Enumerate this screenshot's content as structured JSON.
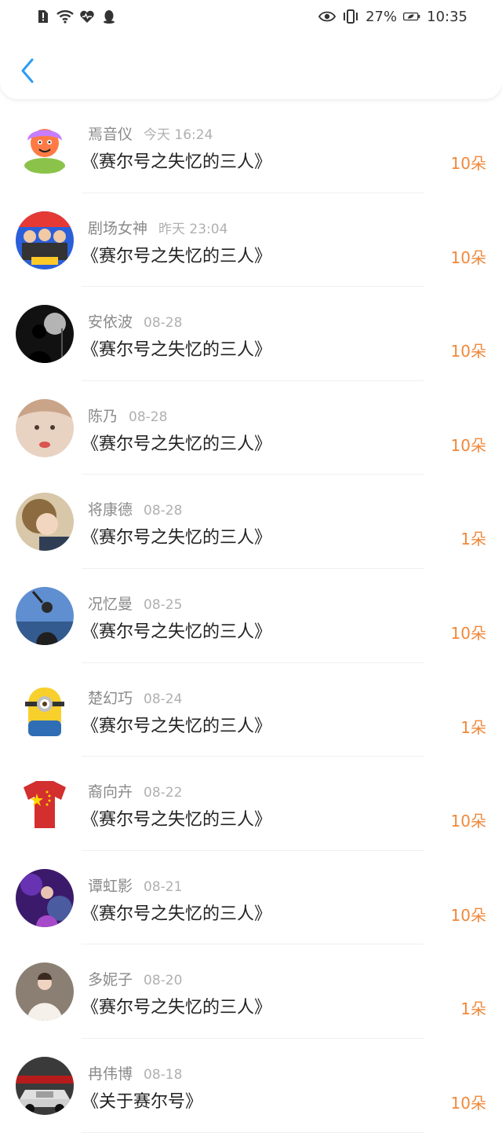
{
  "status_bar": {
    "battery": "27%",
    "time": "10:35"
  },
  "gifts": [
    {
      "name": "焉音仪",
      "time": "今天 16:24",
      "title": "《赛尔号之失忆的三人》",
      "amount": "10朵",
      "avatar": "cartoon-kid"
    },
    {
      "name": "剧场女神",
      "time": "昨天 23:04",
      "title": "《赛尔号之失忆的三人》",
      "amount": "10朵",
      "avatar": "group-photo"
    },
    {
      "name": "安依波",
      "time": "08-28",
      "title": "《赛尔号之失忆的三人》",
      "amount": "10朵",
      "avatar": "night-silhouette"
    },
    {
      "name": "陈乃",
      "time": "08-28",
      "title": "《赛尔号之失忆的三人》",
      "amount": "10朵",
      "avatar": "face-closeup"
    },
    {
      "name": "将康德",
      "time": "08-28",
      "title": "《赛尔号之失忆的三人》",
      "amount": "1朵",
      "avatar": "curly-hair"
    },
    {
      "name": "况忆曼",
      "time": "08-25",
      "title": "《赛尔号之失忆的三人》",
      "amount": "10朵",
      "avatar": "sky-person"
    },
    {
      "name": "楚幻巧",
      "time": "08-24",
      "title": "《赛尔号之失忆的三人》",
      "amount": "1朵",
      "avatar": "minion"
    },
    {
      "name": "裔向卉",
      "time": "08-22",
      "title": "《赛尔号之失忆的三人》",
      "amount": "10朵",
      "avatar": "flag-tshirt"
    },
    {
      "name": "谭虹影",
      "time": "08-21",
      "title": "《赛尔号之失忆的三人》",
      "amount": "10朵",
      "avatar": "purple-stage"
    },
    {
      "name": "多妮子",
      "time": "08-20",
      "title": "《赛尔号之失忆的三人》",
      "amount": "1朵",
      "avatar": "bride"
    },
    {
      "name": "冉伟博",
      "time": "08-18",
      "title": "《关于赛尔号》",
      "amount": "10朵",
      "avatar": "red-car"
    }
  ]
}
